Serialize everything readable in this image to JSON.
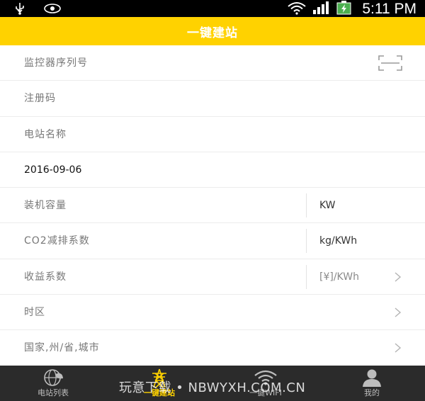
{
  "status_bar": {
    "time": "5:11 PM"
  },
  "header": {
    "title": "一键建站"
  },
  "form": {
    "serial_label": "监控器序列号",
    "register_label": "注册码",
    "station_name_label": "电站名称",
    "date_value": "2016-09-06",
    "capacity_label": "装机容量",
    "capacity_unit": "KW",
    "co2_label": "CO2减排系数",
    "co2_unit": "kg/KWh",
    "income_label": "收益系数",
    "income_unit": "[¥]/KWh",
    "timezone_label": "时区",
    "region_label": "国家,州/省,城市"
  },
  "bottom_nav": {
    "items": [
      {
        "label": "电站列表",
        "icon": "globe-leaf-icon"
      },
      {
        "label": "一键建站",
        "icon": "power-tower-icon"
      },
      {
        "label": "一键WIFI",
        "icon": "wifi-icon"
      },
      {
        "label": "我的",
        "icon": "user-icon"
      }
    ],
    "active_index": 1
  },
  "watermark": "玩意下载 • NBWYXH.COM.CN",
  "colors": {
    "accent": "#ffd200",
    "status_bar": "#000000",
    "nav_bg": "#2b2b2b"
  }
}
